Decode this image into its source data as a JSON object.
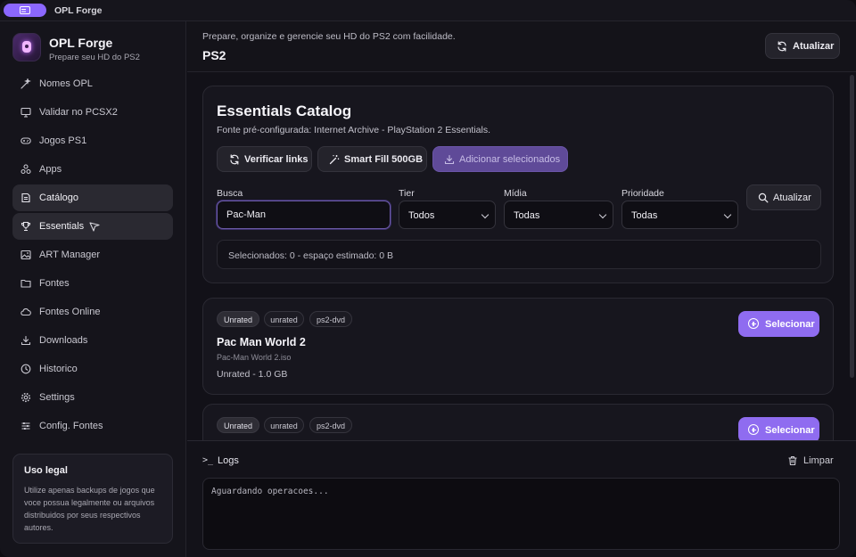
{
  "window": {
    "title": "OPL Forge"
  },
  "brand": {
    "name": "OPL Forge",
    "subtitle": "Prepare seu HD do PS2"
  },
  "nav": {
    "items": [
      {
        "label": "Nomes OPL",
        "icon": "wand-icon",
        "active": false
      },
      {
        "label": "Validar no PCSX2",
        "icon": "monitor-icon",
        "active": false
      },
      {
        "label": "Jogos PS1",
        "icon": "gamepad-icon",
        "active": false
      },
      {
        "label": "Apps",
        "icon": "apps-icon",
        "active": false
      },
      {
        "label": "Catálogo",
        "icon": "catalog-icon",
        "active": true
      },
      {
        "label": "Essentials",
        "icon": "trophy-icon",
        "active": true
      },
      {
        "label": "ART Manager",
        "icon": "image-icon",
        "active": false
      },
      {
        "label": "Fontes",
        "icon": "folder-icon",
        "active": false
      },
      {
        "label": "Fontes Online",
        "icon": "cloud-icon",
        "active": false
      },
      {
        "label": "Downloads",
        "icon": "download-icon",
        "active": false
      },
      {
        "label": "Historico",
        "icon": "clock-icon",
        "active": false
      },
      {
        "label": "Settings",
        "icon": "gear-icon",
        "active": false
      },
      {
        "label": "Config. Fontes",
        "icon": "sliders-icon",
        "active": false
      }
    ]
  },
  "legal": {
    "title": "Uso legal",
    "text": "Utilize apenas backups de jogos que voce possua legalmente ou arquivos distribuidos por seus respectivos autores."
  },
  "header": {
    "subtitle": "Prepare, organize e gerencie seu HD do PS2 com facilidade.",
    "title": "PS2",
    "refresh_label": "Atualizar"
  },
  "catalog": {
    "title": "Essentials Catalog",
    "source": "Fonte pré-configurada: Internet Archive - PlayStation 2 Essentials.",
    "actions": {
      "verify_label": "Verificar links",
      "smart_fill_label": "Smart Fill 500GB",
      "add_selected_label": "Adicionar selecionados"
    },
    "filters": {
      "search_label": "Busca",
      "search_value": "Pac-Man",
      "tier_label": "Tier",
      "tier_value": "Todos",
      "media_label": "Mídia",
      "media_value": "Todas",
      "priority_label": "Prioridade",
      "priority_value": "Todas",
      "refresh_label": "Atualizar"
    },
    "summary": "Selecionados: 0 - espaço estimado: 0 B"
  },
  "games": [
    {
      "tags": [
        "Unrated",
        "unrated",
        "ps2-dvd"
      ],
      "title": "Pac Man World 2",
      "file": "Pac-Man World 2.iso",
      "meta": "Unrated - 1.0 GB",
      "select_label": "Selecionar"
    },
    {
      "tags": [
        "Unrated",
        "unrated",
        "ps2-dvd"
      ],
      "title": "",
      "file": "",
      "meta": "",
      "select_label": "Selecionar"
    }
  ],
  "logs": {
    "prompt": ">_",
    "title": "Logs",
    "clear_label": "Limpar",
    "output": "Aguardando operacoes..."
  },
  "colors": {
    "accent": "#8f6cf0",
    "background": "#121118",
    "sidebar": "#15141b",
    "card": "#17161e"
  }
}
